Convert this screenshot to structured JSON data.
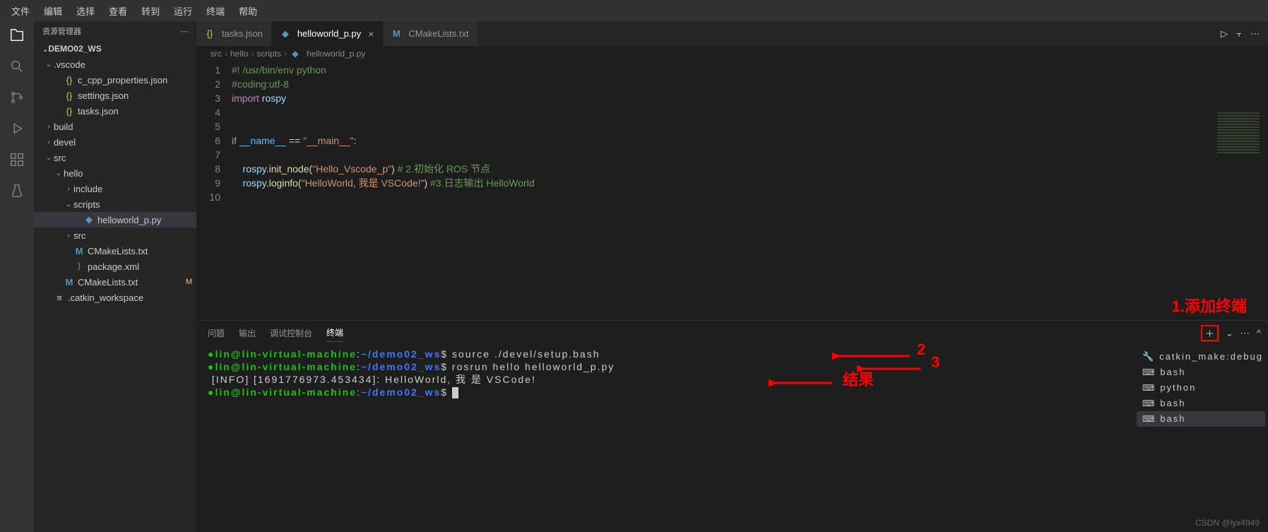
{
  "menubar": [
    "文件",
    "编辑",
    "选择",
    "查看",
    "转到",
    "运行",
    "终端",
    "帮助"
  ],
  "sidebar": {
    "title": "资源管理器",
    "project": "DEMO02_WS",
    "tree": [
      {
        "depth": 0,
        "type": "folder",
        "open": true,
        "label": ".vscode"
      },
      {
        "depth": 1,
        "type": "json",
        "label": "c_cpp_properties.json"
      },
      {
        "depth": 1,
        "type": "json",
        "label": "settings.json"
      },
      {
        "depth": 1,
        "type": "json",
        "label": "tasks.json"
      },
      {
        "depth": 0,
        "type": "folder",
        "open": false,
        "label": "build"
      },
      {
        "depth": 0,
        "type": "folder",
        "open": false,
        "label": "devel"
      },
      {
        "depth": 0,
        "type": "folder",
        "open": true,
        "label": "src"
      },
      {
        "depth": 1,
        "type": "folder",
        "open": true,
        "label": "hello"
      },
      {
        "depth": 2,
        "type": "folder",
        "open": false,
        "label": "include"
      },
      {
        "depth": 2,
        "type": "folder",
        "open": true,
        "label": "scripts"
      },
      {
        "depth": 3,
        "type": "py",
        "label": "helloworld_p.py",
        "selected": true
      },
      {
        "depth": 2,
        "type": "folder",
        "open": false,
        "label": "src"
      },
      {
        "depth": 2,
        "type": "cmake",
        "label": "CMakeLists.txt"
      },
      {
        "depth": 2,
        "type": "xml",
        "label": "package.xml"
      },
      {
        "depth": 1,
        "type": "cmake",
        "label": "CMakeLists.txt",
        "m": true
      },
      {
        "depth": 0,
        "type": "txt",
        "label": ".catkin_workspace"
      }
    ]
  },
  "tabs": [
    {
      "icon": "json",
      "label": "tasks.json",
      "active": false
    },
    {
      "icon": "py",
      "label": "helloworld_p.py",
      "active": true
    },
    {
      "icon": "cmake",
      "label": "CMakeLists.txt",
      "active": false
    }
  ],
  "breadcrumbs": [
    "src",
    "hello",
    "scripts",
    "helloworld_p.py"
  ],
  "code_lines": [
    [
      {
        "t": "#! /usr/bin/env python",
        "c": "c-cmt"
      }
    ],
    [
      {
        "t": "#coding:utf-8",
        "c": "c-cmt"
      }
    ],
    [
      {
        "t": "import ",
        "c": "c-key"
      },
      {
        "t": "rospy",
        "c": "c-id"
      }
    ],
    [],
    [],
    [
      {
        "t": "if ",
        "c": "c-key"
      },
      {
        "t": "__name__ ",
        "c": "c-var"
      },
      {
        "t": "== ",
        "c": ""
      },
      {
        "t": "\"__main__\"",
        "c": "c-str"
      },
      {
        "t": ":",
        "c": ""
      }
    ],
    [],
    [
      {
        "t": "    rospy.",
        "c": "c-id"
      },
      {
        "t": "init_node",
        "c": "c-fn"
      },
      {
        "t": "(",
        "c": ""
      },
      {
        "t": "\"Hello_Vscode_p\"",
        "c": "c-str"
      },
      {
        "t": ") ",
        "c": ""
      },
      {
        "t": "# 2.初始化 ROS 节点",
        "c": "c-cmt"
      }
    ],
    [
      {
        "t": "    rospy.",
        "c": "c-id"
      },
      {
        "t": "loginfo",
        "c": "c-fn"
      },
      {
        "t": "(",
        "c": ""
      },
      {
        "t": "\"HelloWorld, 我是 VSCode!\"",
        "c": "c-str"
      },
      {
        "t": ") ",
        "c": ""
      },
      {
        "t": "#3.日志输出 HelloWorld",
        "c": "c-cmt"
      }
    ],
    []
  ],
  "panel_tabs": [
    "问题",
    "输出",
    "调试控制台",
    "终端"
  ],
  "panel_active": 3,
  "terminal": {
    "prompt_user": "lin@lin-virtual-machine",
    "prompt_path": "~/demo02_ws",
    "cmd1": "source ./devel/setup.bash",
    "cmd2": "rosrun hello helloworld_p.py",
    "info": "[INFO] [1691776973.453434]: HelloWorld, 我 是 VSCode!"
  },
  "terminal_list": {
    "task": "catkin_make:debug",
    "items": [
      "bash",
      "python",
      "bash",
      "bash"
    ],
    "active": 3
  },
  "annotations": {
    "a1": "1.添加终端",
    "a2": "2",
    "a3": "3",
    "res": "结果"
  },
  "watermark": "CSDN @lyx4949"
}
